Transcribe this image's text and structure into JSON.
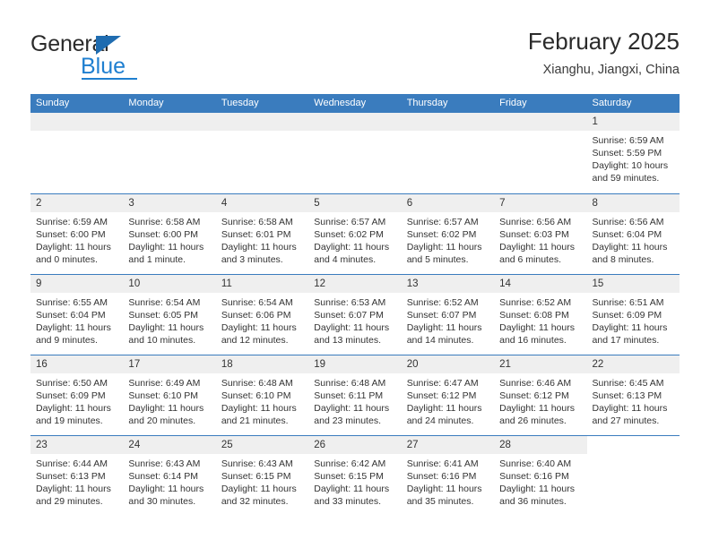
{
  "brand": {
    "name_top": "General",
    "name_bottom": "Blue",
    "accent_color": "#1f7fd0",
    "triangle_color": "#1f6cb0"
  },
  "header": {
    "title": "February 2025",
    "location": "Xianghu, Jiangxi, China"
  },
  "theme": {
    "header_row_bg": "#3a7cbe",
    "daynum_band_bg": "#efefef",
    "row_divider": "#3a7cbe",
    "text_color": "#333333"
  },
  "weekdays": [
    "Sunday",
    "Monday",
    "Tuesday",
    "Wednesday",
    "Thursday",
    "Friday",
    "Saturday"
  ],
  "weeks": [
    [
      {
        "day": "",
        "blank": true
      },
      {
        "day": "",
        "blank": true
      },
      {
        "day": "",
        "blank": true
      },
      {
        "day": "",
        "blank": true
      },
      {
        "day": "",
        "blank": true
      },
      {
        "day": "",
        "blank": true
      },
      {
        "day": "1",
        "sunrise": "Sunrise: 6:59 AM",
        "sunset": "Sunset: 5:59 PM",
        "daylight": "Daylight: 10 hours and 59 minutes."
      }
    ],
    [
      {
        "day": "2",
        "sunrise": "Sunrise: 6:59 AM",
        "sunset": "Sunset: 6:00 PM",
        "daylight": "Daylight: 11 hours and 0 minutes."
      },
      {
        "day": "3",
        "sunrise": "Sunrise: 6:58 AM",
        "sunset": "Sunset: 6:00 PM",
        "daylight": "Daylight: 11 hours and 1 minute."
      },
      {
        "day": "4",
        "sunrise": "Sunrise: 6:58 AM",
        "sunset": "Sunset: 6:01 PM",
        "daylight": "Daylight: 11 hours and 3 minutes."
      },
      {
        "day": "5",
        "sunrise": "Sunrise: 6:57 AM",
        "sunset": "Sunset: 6:02 PM",
        "daylight": "Daylight: 11 hours and 4 minutes."
      },
      {
        "day": "6",
        "sunrise": "Sunrise: 6:57 AM",
        "sunset": "Sunset: 6:02 PM",
        "daylight": "Daylight: 11 hours and 5 minutes."
      },
      {
        "day": "7",
        "sunrise": "Sunrise: 6:56 AM",
        "sunset": "Sunset: 6:03 PM",
        "daylight": "Daylight: 11 hours and 6 minutes."
      },
      {
        "day": "8",
        "sunrise": "Sunrise: 6:56 AM",
        "sunset": "Sunset: 6:04 PM",
        "daylight": "Daylight: 11 hours and 8 minutes."
      }
    ],
    [
      {
        "day": "9",
        "sunrise": "Sunrise: 6:55 AM",
        "sunset": "Sunset: 6:04 PM",
        "daylight": "Daylight: 11 hours and 9 minutes."
      },
      {
        "day": "10",
        "sunrise": "Sunrise: 6:54 AM",
        "sunset": "Sunset: 6:05 PM",
        "daylight": "Daylight: 11 hours and 10 minutes."
      },
      {
        "day": "11",
        "sunrise": "Sunrise: 6:54 AM",
        "sunset": "Sunset: 6:06 PM",
        "daylight": "Daylight: 11 hours and 12 minutes."
      },
      {
        "day": "12",
        "sunrise": "Sunrise: 6:53 AM",
        "sunset": "Sunset: 6:07 PM",
        "daylight": "Daylight: 11 hours and 13 minutes."
      },
      {
        "day": "13",
        "sunrise": "Sunrise: 6:52 AM",
        "sunset": "Sunset: 6:07 PM",
        "daylight": "Daylight: 11 hours and 14 minutes."
      },
      {
        "day": "14",
        "sunrise": "Sunrise: 6:52 AM",
        "sunset": "Sunset: 6:08 PM",
        "daylight": "Daylight: 11 hours and 16 minutes."
      },
      {
        "day": "15",
        "sunrise": "Sunrise: 6:51 AM",
        "sunset": "Sunset: 6:09 PM",
        "daylight": "Daylight: 11 hours and 17 minutes."
      }
    ],
    [
      {
        "day": "16",
        "sunrise": "Sunrise: 6:50 AM",
        "sunset": "Sunset: 6:09 PM",
        "daylight": "Daylight: 11 hours and 19 minutes."
      },
      {
        "day": "17",
        "sunrise": "Sunrise: 6:49 AM",
        "sunset": "Sunset: 6:10 PM",
        "daylight": "Daylight: 11 hours and 20 minutes."
      },
      {
        "day": "18",
        "sunrise": "Sunrise: 6:48 AM",
        "sunset": "Sunset: 6:10 PM",
        "daylight": "Daylight: 11 hours and 21 minutes."
      },
      {
        "day": "19",
        "sunrise": "Sunrise: 6:48 AM",
        "sunset": "Sunset: 6:11 PM",
        "daylight": "Daylight: 11 hours and 23 minutes."
      },
      {
        "day": "20",
        "sunrise": "Sunrise: 6:47 AM",
        "sunset": "Sunset: 6:12 PM",
        "daylight": "Daylight: 11 hours and 24 minutes."
      },
      {
        "day": "21",
        "sunrise": "Sunrise: 6:46 AM",
        "sunset": "Sunset: 6:12 PM",
        "daylight": "Daylight: 11 hours and 26 minutes."
      },
      {
        "day": "22",
        "sunrise": "Sunrise: 6:45 AM",
        "sunset": "Sunset: 6:13 PM",
        "daylight": "Daylight: 11 hours and 27 minutes."
      }
    ],
    [
      {
        "day": "23",
        "sunrise": "Sunrise: 6:44 AM",
        "sunset": "Sunset: 6:13 PM",
        "daylight": "Daylight: 11 hours and 29 minutes."
      },
      {
        "day": "24",
        "sunrise": "Sunrise: 6:43 AM",
        "sunset": "Sunset: 6:14 PM",
        "daylight": "Daylight: 11 hours and 30 minutes."
      },
      {
        "day": "25",
        "sunrise": "Sunrise: 6:43 AM",
        "sunset": "Sunset: 6:15 PM",
        "daylight": "Daylight: 11 hours and 32 minutes."
      },
      {
        "day": "26",
        "sunrise": "Sunrise: 6:42 AM",
        "sunset": "Sunset: 6:15 PM",
        "daylight": "Daylight: 11 hours and 33 minutes."
      },
      {
        "day": "27",
        "sunrise": "Sunrise: 6:41 AM",
        "sunset": "Sunset: 6:16 PM",
        "daylight": "Daylight: 11 hours and 35 minutes."
      },
      {
        "day": "28",
        "sunrise": "Sunrise: 6:40 AM",
        "sunset": "Sunset: 6:16 PM",
        "daylight": "Daylight: 11 hours and 36 minutes."
      },
      {
        "day": "",
        "nocell": true
      }
    ]
  ]
}
